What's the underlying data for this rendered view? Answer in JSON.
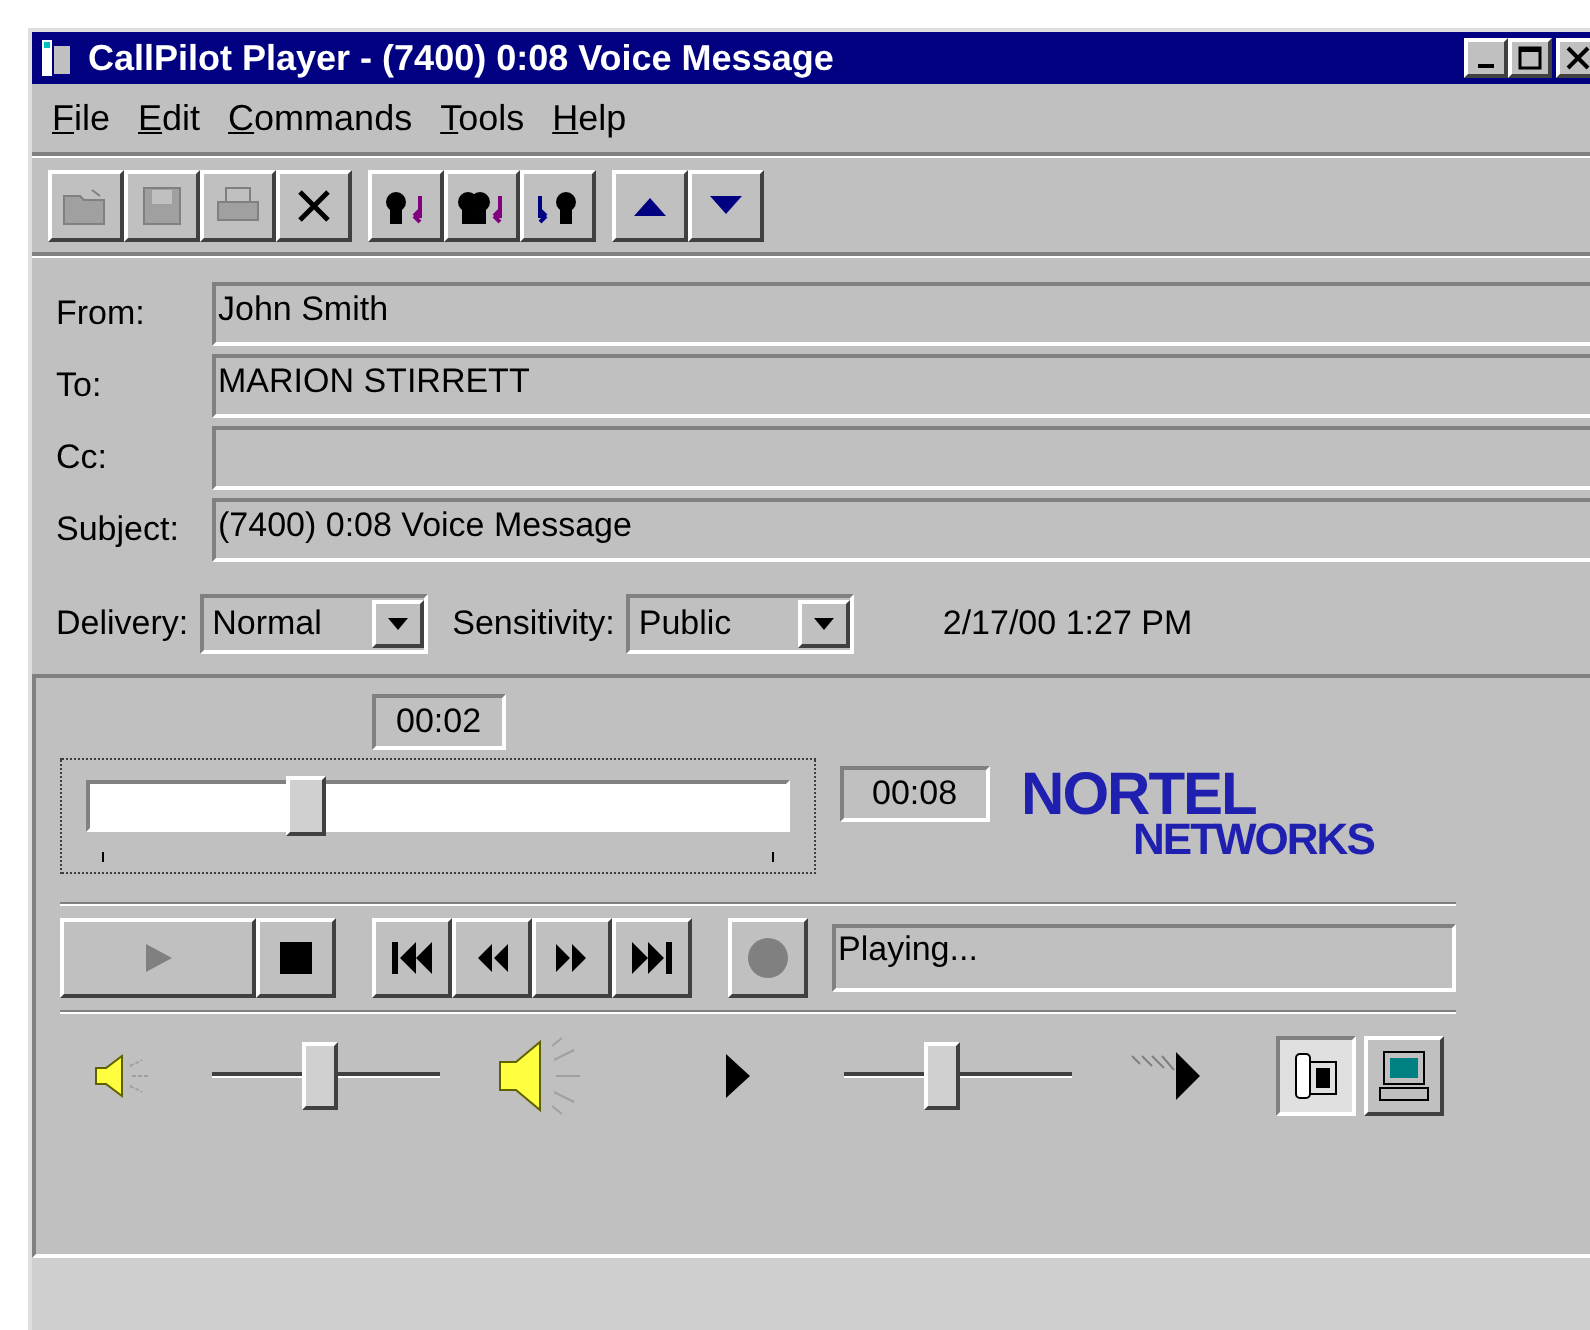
{
  "window": {
    "title": "CallPilot Player - (7400) 0:08 Voice Message"
  },
  "menu": [
    "File",
    "Edit",
    "Commands",
    "Tools",
    "Help"
  ],
  "toolbar": [
    {
      "kind": "open",
      "disabled": true
    },
    {
      "kind": "save",
      "disabled": true
    },
    {
      "kind": "print",
      "disabled": true
    },
    {
      "kind": "delete",
      "disabled": false
    },
    {
      "kind": "reply",
      "disabled": false
    },
    {
      "kind": "reply-all",
      "disabled": false
    },
    {
      "kind": "forward",
      "disabled": false
    },
    {
      "kind": "previous",
      "disabled": false
    },
    {
      "kind": "next",
      "disabled": false
    }
  ],
  "fields": [
    {
      "label": "From:",
      "value": "John  Smith"
    },
    {
      "label": "To:",
      "value": "MARION STIRRETT"
    },
    {
      "label": "Cc:"
    },
    {
      "label": "Subject:",
      "value": "(7400) 0:08 Voice Message"
    }
  ],
  "delivery": {
    "label": "Delivery:",
    "value": "Normal"
  },
  "sensitivity": {
    "label": "Sensitivity:",
    "value": "Public"
  },
  "date": "2/17/00 1:27 PM",
  "player": {
    "elapsed": "00:02",
    "total": "00:08",
    "level": 0.3,
    "logo": [
      "NORTEL",
      "NETWORKS"
    ],
    "transport": [
      {
        "kind": "play",
        "disabled": true
      },
      {
        "kind": "stop",
        "disabled": false
      },
      {
        "kind": "first",
        "disabled": false
      },
      {
        "kind": "rewind",
        "disabled": false
      },
      {
        "kind": "fast-forward",
        "disabled": false
      },
      {
        "kind": "last",
        "disabled": false
      },
      {
        "kind": "record",
        "disabled": true
      }
    ],
    "status": "Playing...",
    "volume": {
      "level": 0.47
    },
    "speed": {
      "level": 0.42
    },
    "outputs": [
      {
        "kind": "phone",
        "selected": true
      },
      {
        "kind": "computer",
        "selected": false
      }
    ]
  }
}
